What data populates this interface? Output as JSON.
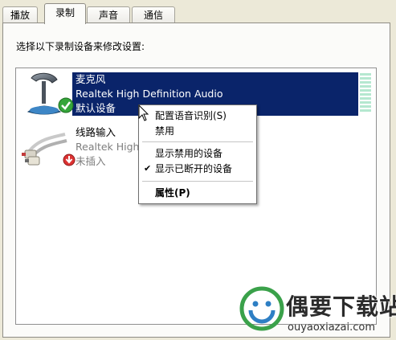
{
  "tabs": [
    {
      "label": "播放"
    },
    {
      "label": "录制"
    },
    {
      "label": "声音"
    },
    {
      "label": "通信"
    }
  ],
  "active_tab": "录制",
  "instruction": "选择以下录制设备来修改设置:",
  "devices": [
    {
      "name": "麦克风",
      "driver": "Realtek High Definition Audio",
      "status": "默认设备",
      "selected": true,
      "icon": "microphone-icon",
      "badge": "green-check-icon"
    },
    {
      "name": "线路输入",
      "driver": "Realtek High",
      "status": "未插入",
      "selected": false,
      "icon": "line-in-cable-icon",
      "badge": "red-down-arrow-icon"
    }
  ],
  "context_menu": {
    "items": [
      {
        "label": "配置语音识别(S)",
        "checked": false
      },
      {
        "label": "禁用",
        "checked": false
      },
      {
        "label": "显示禁用的设备",
        "checked": false
      },
      {
        "label": "显示已断开的设备",
        "checked": true
      },
      {
        "label": "属性(P)",
        "checked": false,
        "bold": true
      }
    ],
    "check_glyph": "✔"
  },
  "watermark": {
    "title": "偶要下载站",
    "url": "ouyaoxiazai.com"
  },
  "colors": {
    "selection": "#0a246a",
    "panel": "#fbfbf9",
    "dialog": "#ece9d8",
    "level_meter": "#b5e8d0"
  }
}
